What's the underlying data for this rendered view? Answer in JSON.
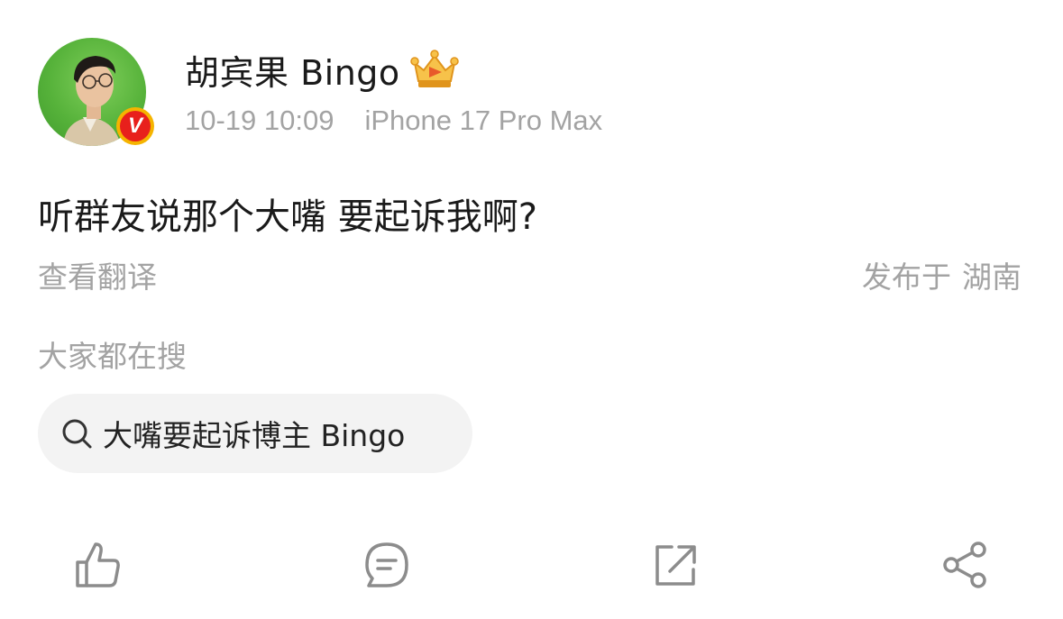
{
  "post": {
    "author": {
      "name": "胡宾果 Bingo",
      "verified_badge": "V",
      "crown_icon": "crown-badge-icon"
    },
    "meta": {
      "time": "10-19 10:09",
      "device": "iPhone 17 Pro Max"
    },
    "text": "听群友说那个大嘴 要起诉我啊?",
    "translate_label": "查看翻译",
    "location": {
      "prefix": "发布于",
      "place": "湖南"
    }
  },
  "search": {
    "title": "大家都在搜",
    "query": "大嘴要起诉博主 Bingo",
    "icon": "search-icon"
  },
  "actions": [
    {
      "icon": "thumbs-up-icon"
    },
    {
      "icon": "comment-icon"
    },
    {
      "icon": "repost-icon"
    },
    {
      "icon": "share-icon"
    }
  ],
  "colors": {
    "text_primary": "#1a1a1a",
    "text_secondary": "#a3a3a3",
    "pill_bg": "#f3f3f3",
    "avatar_bg": "#56b23a",
    "verified_red": "#e8201c",
    "verified_ring": "#f5b400",
    "icon_gray": "#8c8c8c"
  }
}
